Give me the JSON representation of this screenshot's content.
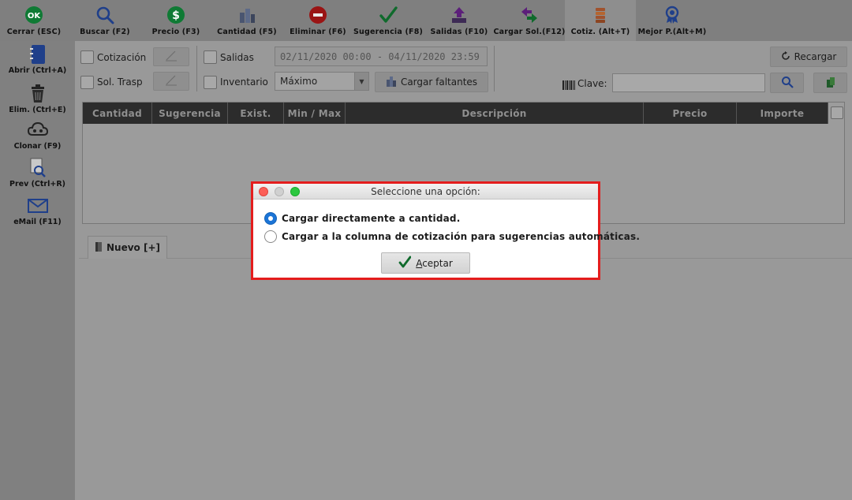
{
  "toolbar": {
    "items": [
      {
        "label": "Cerrar (ESC)",
        "icon": "ok-close-icon"
      },
      {
        "label": "Buscar (F2)",
        "icon": "search-icon"
      },
      {
        "label": "Precio (F3)",
        "icon": "dollar-icon"
      },
      {
        "label": "Cantidad (F5)",
        "icon": "quantity-icon"
      },
      {
        "label": "Eliminar (F6)",
        "icon": "delete-icon"
      },
      {
        "label": "Sugerencia (F8)",
        "icon": "checkmark-icon"
      },
      {
        "label": "Salidas (F10)",
        "icon": "outbox-icon"
      },
      {
        "label": "Cargar Sol.(F12)",
        "icon": "swap-arrows-icon"
      },
      {
        "label": "Cotiz. (Alt+T)",
        "icon": "coins-icon"
      },
      {
        "label": "Mejor P.(Alt+M)",
        "icon": "award-ribbon-icon"
      }
    ]
  },
  "sidebar": {
    "items": [
      {
        "label": "Abrir (Ctrl+A)",
        "icon": "notebook-icon"
      },
      {
        "label": "Elim. (Ctrl+E)",
        "icon": "trash-icon"
      },
      {
        "label": "Clonar (F9)",
        "icon": "clone-cloud-icon"
      },
      {
        "label": "Prev (Ctrl+R)",
        "icon": "preview-document-icon"
      },
      {
        "label": "eMail (F11)",
        "icon": "envelope-icon"
      }
    ]
  },
  "filters": {
    "cotizacion_label": "Cotización",
    "sol_trasp_label": "Sol. Trasp",
    "salidas_label": "Salidas",
    "inventario_label": "Inventario",
    "date_range": "02/11/2020 00:00 - 04/11/2020 23:59",
    "inventario_option": "Máximo",
    "cargar_faltantes_label": "Cargar faltantes",
    "recargar_label": "Recargar",
    "clave_label": "Clave:",
    "clave_value": ""
  },
  "grid": {
    "columns": [
      "Cantidad",
      "Sugerencia",
      "Exist.",
      "Min / Max",
      "Descripción",
      "Precio",
      "Importe"
    ],
    "rows": []
  },
  "tabs": [
    {
      "label": "Nuevo [+]"
    }
  ],
  "dialog": {
    "title": "Seleccione una opción:",
    "options": [
      {
        "label": "Cargar directamente a cantidad.",
        "selected": true
      },
      {
        "label": "Cargar a la columna de cotización para sugerencias  automáticas.",
        "selected": false
      }
    ],
    "accept_label": "Aceptar",
    "accept_mnemonic": "A",
    "accept_rest": "ceptar",
    "highlight_color": "#e41d1d",
    "radio_color": "#1b74d6"
  }
}
